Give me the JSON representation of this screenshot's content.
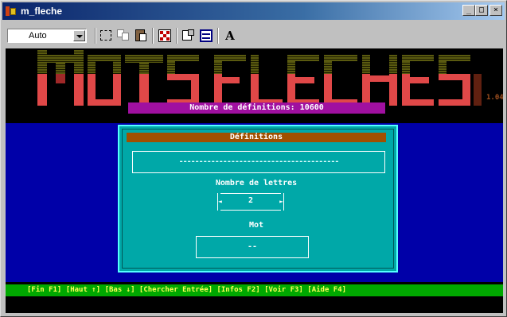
{
  "window": {
    "title": "m_fleche",
    "minimize_label": "_",
    "maximize_label": "□",
    "close_label": "×"
  },
  "toolbar": {
    "font_size_value": "Auto",
    "buttons": [
      "select-icon",
      "copy-icon",
      "paste-icon",
      "fullscreen-icon",
      "properties-icon",
      "background-icon",
      "font-icon"
    ],
    "font_button_label": "A"
  },
  "console": {
    "banner_logo_text": "MOTS FLECHES",
    "version": "1.04",
    "definitions_count_label": "Nombre de définitions: 10600",
    "dialog": {
      "title": "Définitions",
      "definition_value": "----------------------------------------",
      "letters_label": "Nombre de lettres",
      "letters_left_arrow": "◄",
      "letters_value": "2",
      "letters_right_arrow": "►",
      "word_label": "Mot",
      "word_value": "--"
    },
    "status_bar": [
      {
        "text": "[Fin F1]"
      },
      {
        "text": "[Haut ↑]"
      },
      {
        "text": "[Bas ↓]"
      },
      {
        "text": "[Chercher Entrée]"
      },
      {
        "text": "[Infos F2]"
      },
      {
        "text": "[Voir F3]"
      },
      {
        "text": "[Aide F4]"
      }
    ]
  },
  "colors": {
    "console_bg": "#000000",
    "desktop_blue": "#0000a8",
    "dialog_cyan": "#00a8a8",
    "title_brown": "#a05000",
    "count_magenta": "#a010a0",
    "status_green": "#00a800",
    "banner_red": "#e04848",
    "banner_olive": "#5a5a10"
  }
}
